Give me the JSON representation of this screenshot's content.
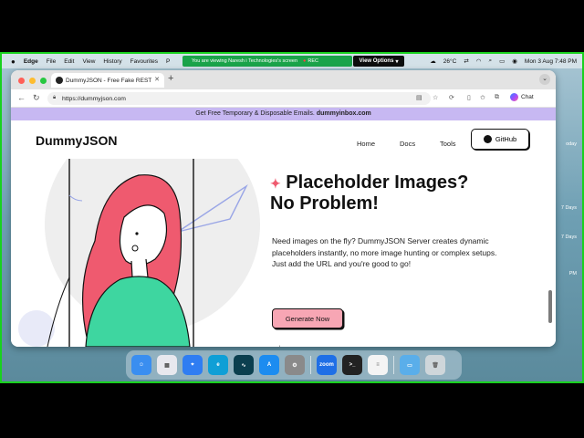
{
  "menubar": {
    "app": "Edge",
    "items": [
      "File",
      "Edit",
      "View",
      "History",
      "Favourites",
      "P"
    ],
    "share_text": "You are viewing  Naresh i Technologies's screen",
    "rec_label": "REC",
    "view_options": "View Options",
    "weather": "26°C",
    "datetime": "Mon 3 Aug  7:48 PM"
  },
  "desktop": {
    "side_labels": [
      "oday",
      "7 Days",
      "7 Days",
      "PM"
    ]
  },
  "browser": {
    "tab_title": "DummyJSON - Free Fake REST",
    "new_tab": "+",
    "url": "https://dummyjson.com",
    "chat_label": "Chat"
  },
  "site": {
    "banner_text": "Get Free Temporary & Disposable Emails.",
    "banner_link": "dummyinbox.com",
    "logo": "DummyJSON",
    "nav": [
      "Home",
      "Docs",
      "Tools"
    ],
    "github_label": "GitHub",
    "hero_title_line1": "Placeholder Images?",
    "hero_title_line2": "No Problem!",
    "hero_body": "Need images on the fly? DummyJSON Server creates dynamic placeholders instantly, no more image hunting or complex setups. Just add the URL and you're good to go!",
    "cta": "Generate Now"
  },
  "colors": {
    "accent_pink": "#f7a6b4",
    "banner_purple": "#c7b8f2",
    "hair": "#ef5a6f",
    "shirt": "#3ed6a0",
    "screen_border": "#19d11f"
  }
}
